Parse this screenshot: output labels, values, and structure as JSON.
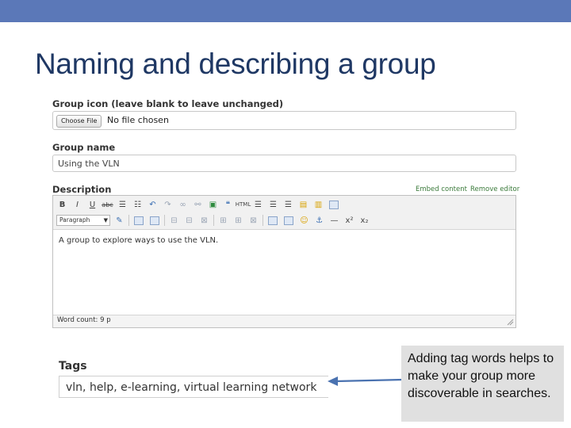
{
  "slide": {
    "title": "Naming and describing a group",
    "accent_color": "#5b78b8",
    "title_color": "#1f3864"
  },
  "form": {
    "icon_label": "Group icon (leave blank to leave unchanged)",
    "icon_button": "Choose File",
    "icon_status": "No file chosen",
    "name_label": "Group name",
    "name_value": "Using the VLN",
    "description_label": "Description",
    "embed_link": "Embed content",
    "remove_editor_link": "Remove editor",
    "toolbar_row1": [
      "bold-icon",
      "italic-icon",
      "underline-icon",
      "strikethrough-icon",
      "bullet-list-icon",
      "numbered-list-icon",
      "undo-icon",
      "redo-icon",
      "link-icon",
      "unlink-icon",
      "image-icon",
      "blockquote-icon",
      "html-icon",
      "align-left-icon",
      "align-center-icon",
      "align-right-icon",
      "paste-icon",
      "paste-word-icon",
      "fullscreen-icon"
    ],
    "toolbar_row2": [
      "format-select",
      "edit-icon",
      "table-icon",
      "table-row-icon",
      "table-col-icon",
      "emoticon-icon",
      "anchor-icon",
      "horizontal-rule-icon",
      "superscript-icon",
      "subscript-icon"
    ],
    "format_value": "Paragraph",
    "html_label": "HTML",
    "description_text": "A group to explore ways to use the VLN.",
    "word_count": "Word count: 9 p",
    "tags_label": "Tags",
    "tags_value": "vln, help, e-learning, virtual learning network"
  },
  "callout": {
    "text": "Adding tag words helps to make your group more discoverable in searches.",
    "arrow_color": "#4a72b0"
  }
}
